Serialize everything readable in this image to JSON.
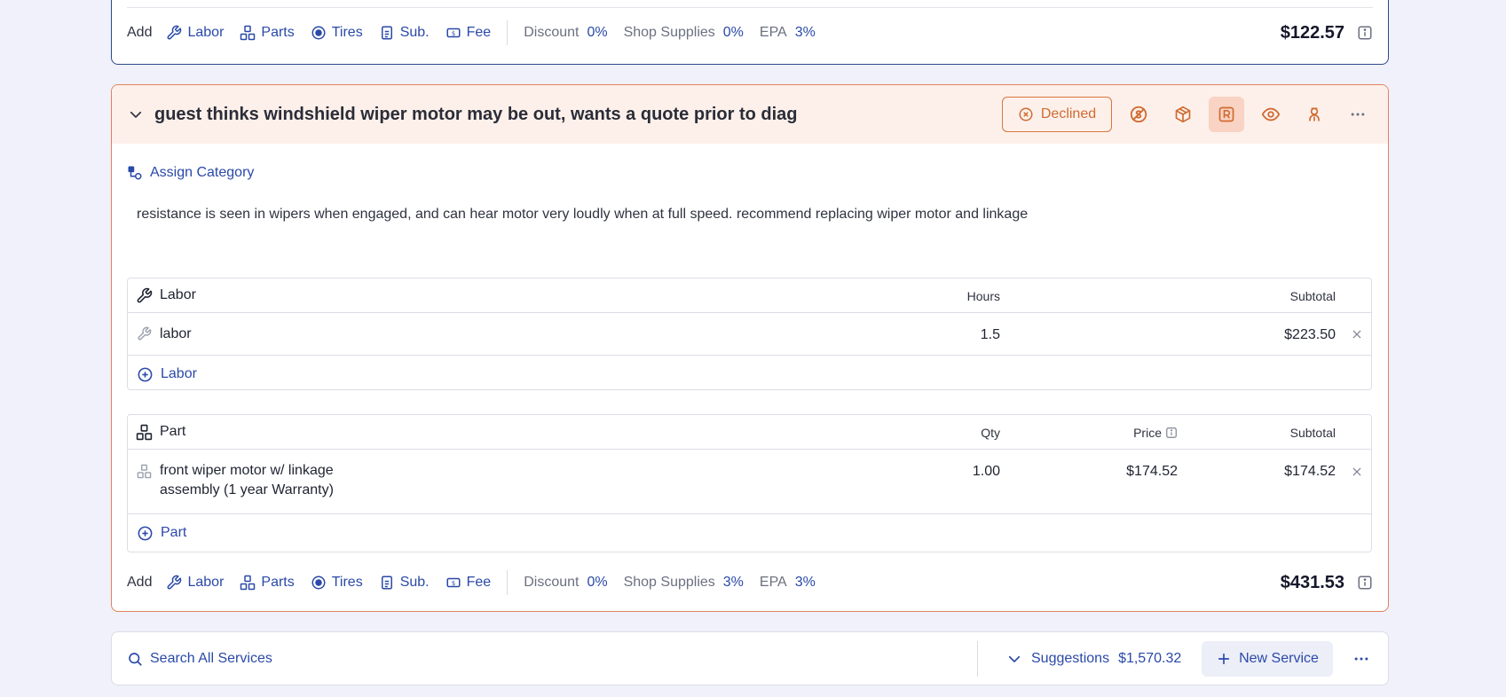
{
  "top_card": {
    "addbar": {
      "add_label": "Add",
      "labor": "Labor",
      "parts": "Parts",
      "tires": "Tires",
      "sub": "Sub.",
      "fee": "Fee",
      "discount_label": "Discount",
      "discount_value": "0%",
      "supplies_label": "Shop Supplies",
      "supplies_value": "0%",
      "epa_label": "EPA",
      "epa_value": "3%",
      "total": "$122.57"
    }
  },
  "service": {
    "title": "guest thinks windshield wiper motor may be out, wants a quote prior to diag",
    "status": "Declined",
    "status_color": "#d06a30",
    "assign_category": "Assign Category",
    "description": "resistance is seen in wipers when engaged, and can hear motor very loudly when at full speed. recommend replacing wiper motor and linkage",
    "labor_table": {
      "title": "Labor",
      "col_hours": "Hours",
      "col_subtotal": "Subtotal",
      "rows": [
        {
          "name": "labor",
          "hours": "1.5",
          "subtotal": "$223.50"
        }
      ],
      "add_label": "Labor"
    },
    "part_table": {
      "title": "Part",
      "col_qty": "Qty",
      "col_price": "Price",
      "col_subtotal": "Subtotal",
      "rows": [
        {
          "name_line1": "front wiper motor w/ linkage",
          "name_line2": "assembly (1 year Warranty)",
          "qty": "1.00",
          "price": "$174.52",
          "subtotal": "$174.52"
        }
      ],
      "add_label": "Part"
    },
    "addbar": {
      "add_label": "Add",
      "labor": "Labor",
      "parts": "Parts",
      "tires": "Tires",
      "sub": "Sub.",
      "fee": "Fee",
      "discount_label": "Discount",
      "discount_value": "0%",
      "supplies_label": "Shop Supplies",
      "supplies_value": "3%",
      "epa_label": "EPA",
      "epa_value": "3%",
      "total": "$431.53"
    }
  },
  "footer": {
    "search_label": "Search All Services",
    "suggestions_label": "Suggestions",
    "suggestions_amount": "$1,570.32",
    "new_service": "New Service"
  },
  "colors": {
    "accent": "#2a49a8",
    "declined_border": "#e0815f",
    "header_bg": "#fdf0ea"
  }
}
